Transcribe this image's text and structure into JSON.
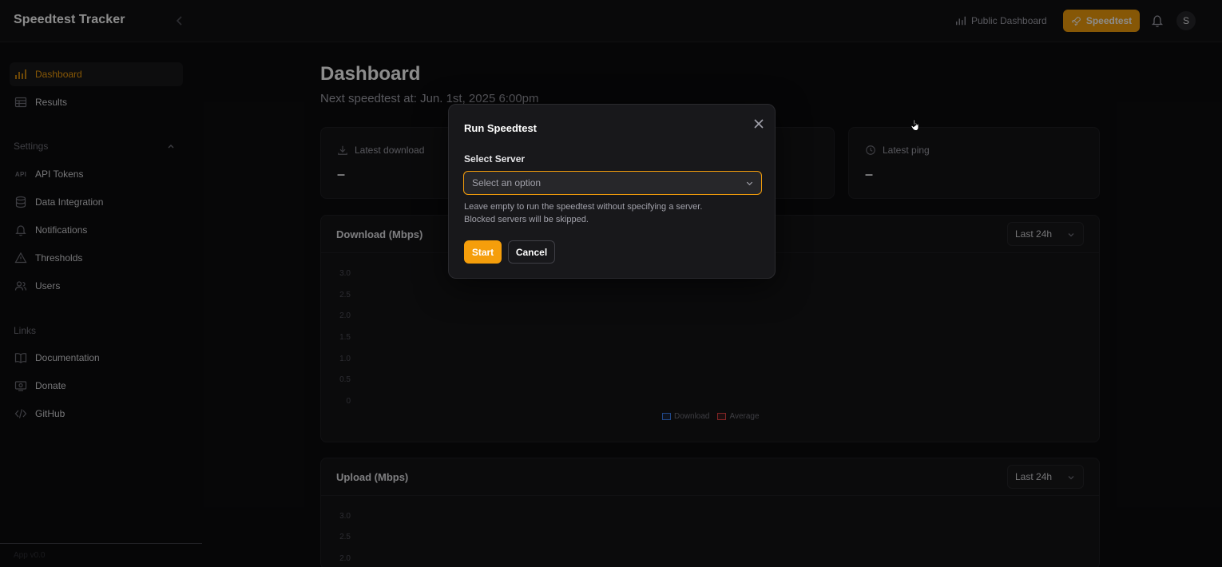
{
  "app": {
    "title": "Speedtest Tracker",
    "version": "App v0.0"
  },
  "topbar": {
    "public_dashboard_label": "Public Dashboard",
    "speedtest_label": "Speedtest",
    "avatar_initial": "S"
  },
  "sidebar": {
    "items": [
      {
        "label": "Dashboard",
        "icon": "chart-bar-icon",
        "active": true
      },
      {
        "label": "Results",
        "icon": "table-icon"
      }
    ],
    "settings": {
      "heading": "Settings",
      "items": [
        {
          "label": "API Tokens",
          "icon": "api-icon"
        },
        {
          "label": "Data Integration",
          "icon": "database-icon"
        },
        {
          "label": "Notifications",
          "icon": "bell-icon"
        },
        {
          "label": "Thresholds",
          "icon": "warning-triangle-icon"
        },
        {
          "label": "Users",
          "icon": "users-icon"
        }
      ]
    },
    "links": {
      "heading": "Links",
      "items": [
        {
          "label": "Documentation",
          "icon": "book-icon"
        },
        {
          "label": "Donate",
          "icon": "donate-icon"
        },
        {
          "label": "GitHub",
          "icon": "code-icon"
        }
      ]
    },
    "api_glyph": "API"
  },
  "dashboard": {
    "title": "Dashboard",
    "next_speedtest": "Next speedtest at: Jun. 1st, 2025 6:00pm",
    "stats": [
      {
        "label": "Latest download",
        "value": "–"
      },
      {
        "label": "Latest ping",
        "value": "–"
      }
    ],
    "charts": {
      "download": {
        "title": "Download (Mbps)",
        "range": "Last 24h",
        "yticks": [
          "3.0",
          "2.5",
          "2.0",
          "1.5",
          "1.0",
          "0.5",
          "0"
        ],
        "legend": [
          {
            "name": "Download",
            "color": "#3b82f6"
          },
          {
            "name": "Average",
            "color": "#ef4444"
          }
        ]
      },
      "upload": {
        "title": "Upload (Mbps)",
        "range": "Last 24h",
        "yticks": [
          "3.0",
          "2.5",
          "2.0"
        ]
      }
    }
  },
  "modal": {
    "title": "Run Speedtest",
    "field_label": "Select Server",
    "select_placeholder": "Select an option",
    "helper_line1": "Leave empty to run the speedtest without specifying a server.",
    "helper_line2": "Blocked servers will be skipped.",
    "start_label": "Start",
    "cancel_label": "Cancel"
  },
  "colors": {
    "accent": "#f59e0b",
    "background": "#0c0c0e",
    "card": "#141417"
  }
}
